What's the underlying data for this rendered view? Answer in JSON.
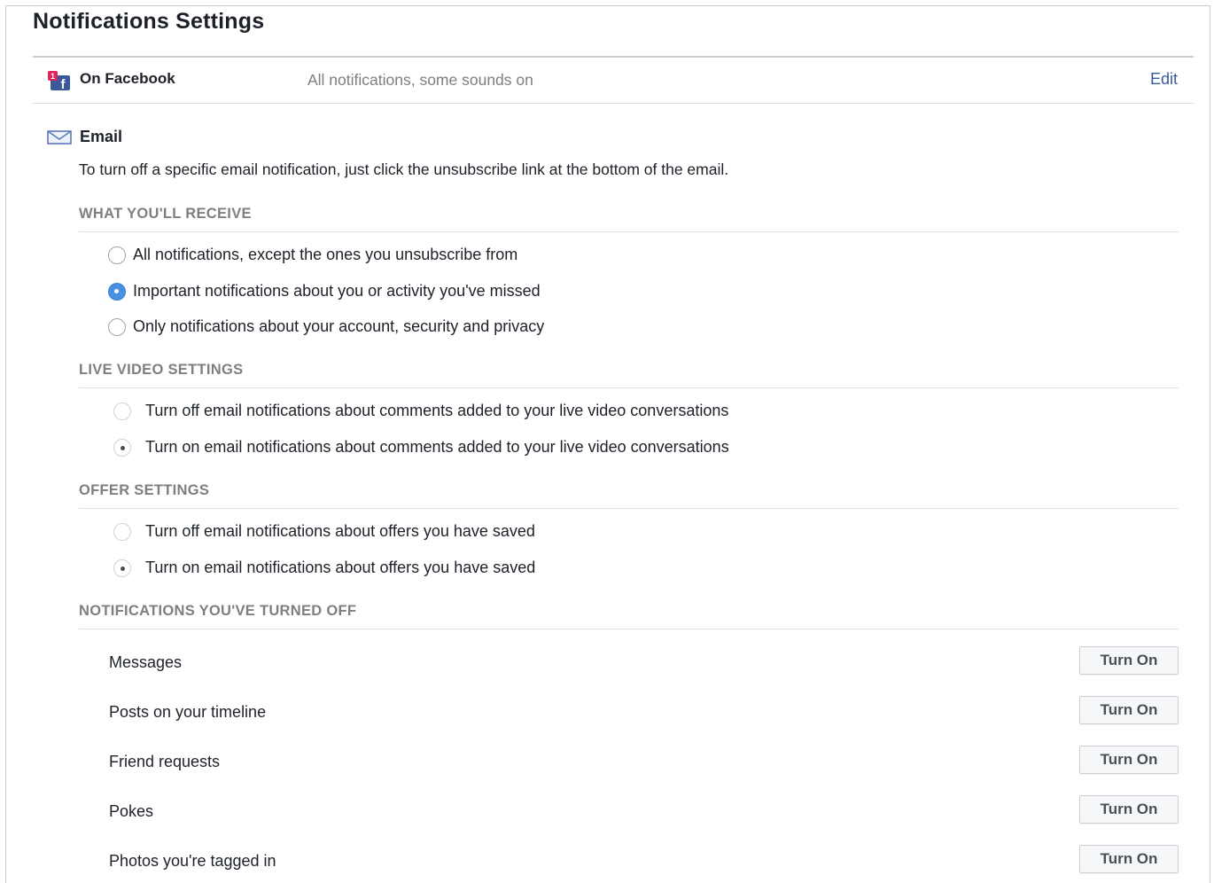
{
  "page": {
    "title": "Notifications Settings"
  },
  "on_facebook": {
    "label": "On Facebook",
    "status": "All notifications, some sounds on",
    "edit_label": "Edit",
    "icon": "facebook-icon",
    "badge_count": "1",
    "logo_letter": "f"
  },
  "email": {
    "label": "Email",
    "icon": "envelope-icon",
    "description": "To turn off a specific email notification, just click the unsubscribe link at the bottom of the email.",
    "receive": {
      "heading": "WHAT YOU'LL RECEIVE",
      "options": [
        {
          "label": "All notifications, except the ones you unsubscribe from",
          "selected": false
        },
        {
          "label": "Important notifications about you or activity you've missed",
          "selected": true
        },
        {
          "label": "Only notifications about your account, security and privacy",
          "selected": false
        }
      ]
    },
    "live_video": {
      "heading": "LIVE VIDEO SETTINGS",
      "options": [
        {
          "label": "Turn off email notifications about comments added to your live video conversations",
          "selected": false
        },
        {
          "label": "Turn on email notifications about comments added to your live video conversations",
          "selected": true
        }
      ]
    },
    "offer": {
      "heading": "OFFER SETTINGS",
      "options": [
        {
          "label": "Turn off email notifications about offers you have saved",
          "selected": false
        },
        {
          "label": "Turn on email notifications about offers you have saved",
          "selected": true
        }
      ]
    },
    "turned_off": {
      "heading": "NOTIFICATIONS YOU'VE TURNED OFF",
      "button_label": "Turn On",
      "items": [
        {
          "label": "Messages"
        },
        {
          "label": "Posts on your timeline"
        },
        {
          "label": "Friend requests"
        },
        {
          "label": "Pokes"
        },
        {
          "label": "Photos you're tagged in"
        }
      ]
    }
  },
  "colors": {
    "link": "#365899",
    "muted": "#7f7f7f",
    "radio_selected": "#4a90e2",
    "facebook_blue": "#3b5998",
    "badge_red": "#e0245e"
  }
}
